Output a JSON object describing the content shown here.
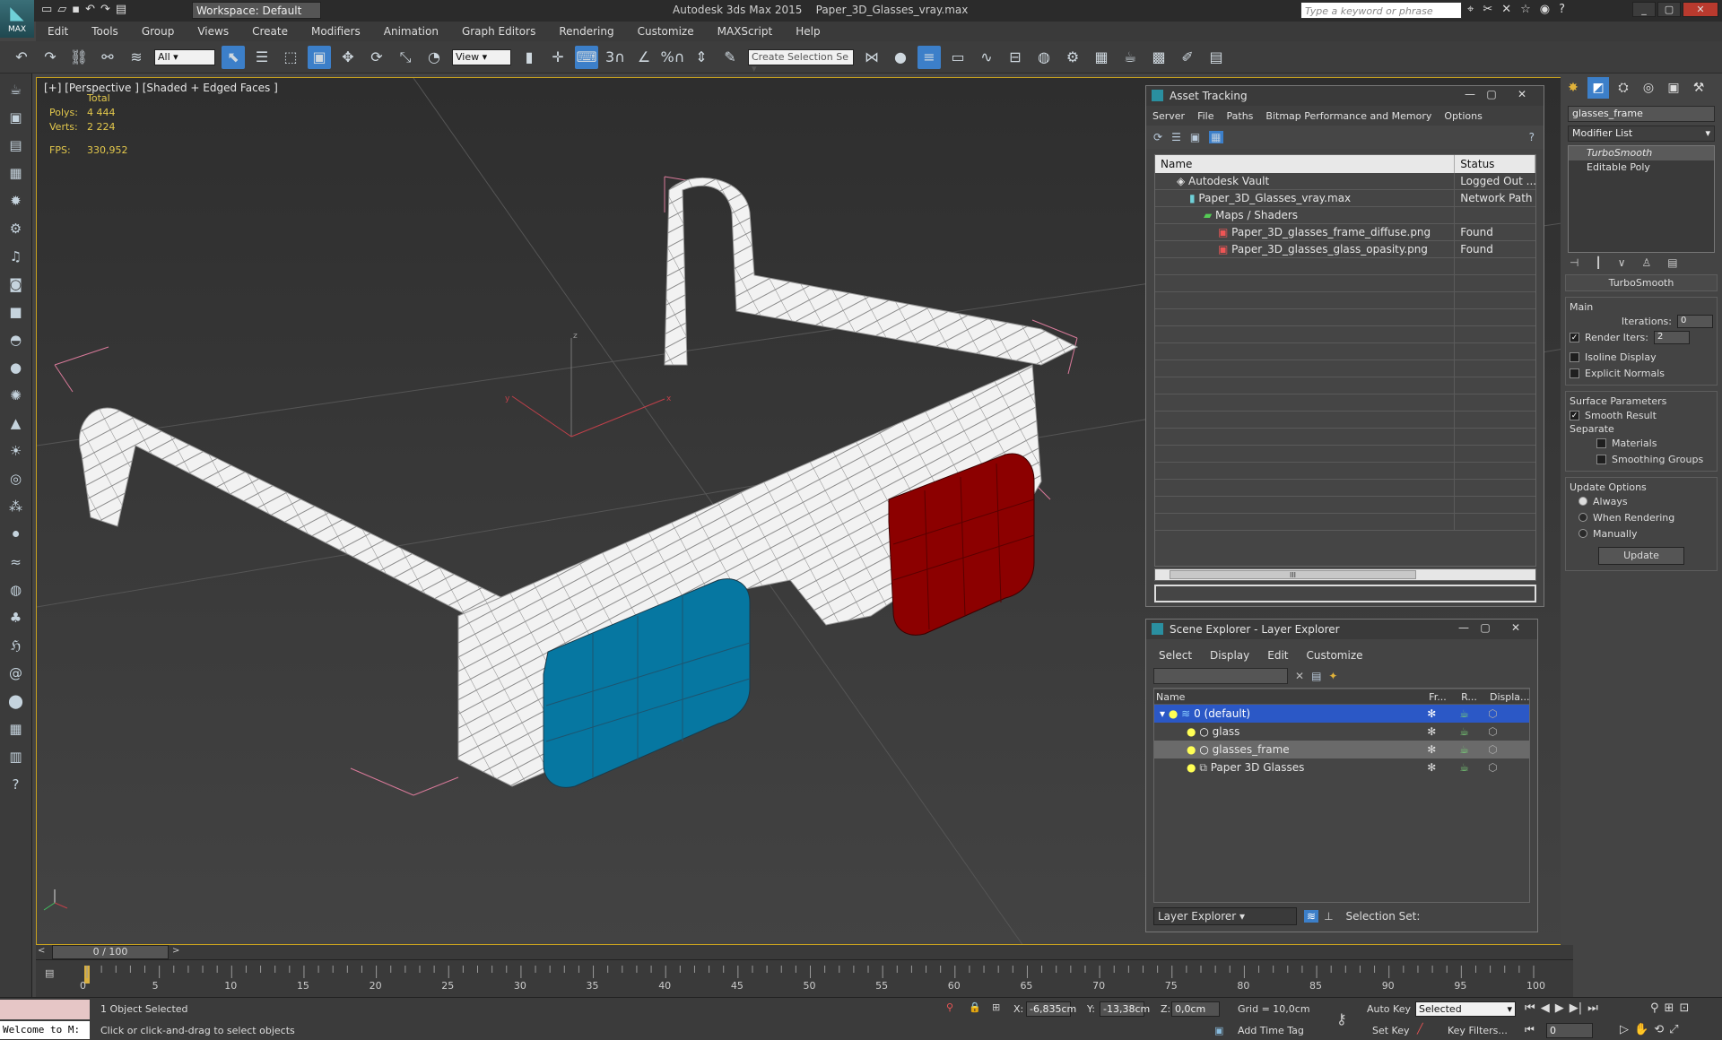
{
  "app": {
    "title_app": "Autodesk 3ds Max 2015",
    "title_file": "Paper_3D_Glasses_vray.max",
    "logo_text": "MAX",
    "workspace": "Workspace: Default",
    "search_placeholder": "Type a keyword or phrase"
  },
  "menu": [
    "Edit",
    "Tools",
    "Group",
    "Views",
    "Create",
    "Modifiers",
    "Animation",
    "Graph Editors",
    "Rendering",
    "Customize",
    "MAXScript",
    "Help"
  ],
  "toolbar": {
    "filter_value": "All",
    "view_value": "View",
    "selection_set_placeholder": "Create Selection Se",
    "snap_labels": [
      "3",
      "%",
      "n"
    ]
  },
  "viewport": {
    "label": "[+] [Perspective ] [Shaded + Edged Faces ]",
    "stats_total_label": "Total",
    "polys_label": "Polys:",
    "polys_value": "4 444",
    "verts_label": "Verts:",
    "verts_value": "2 224",
    "fps_label": "FPS:",
    "fps_value": "330,952",
    "axis_x": "x",
    "axis_y": "y",
    "axis_z": "z"
  },
  "asset_tracking": {
    "title": "Asset Tracking",
    "menu": [
      "Server",
      "File",
      "Paths",
      "Bitmap Performance and Memory",
      "Options"
    ],
    "columns": [
      "Name",
      "Status"
    ],
    "rows": [
      {
        "name": "Autodesk Vault",
        "status": "Logged Out ..."
      },
      {
        "name": "Paper_3D_Glasses_vray.max",
        "status": "Network Path"
      },
      {
        "name": "Maps / Shaders",
        "status": ""
      },
      {
        "name": "Paper_3D_glasses_frame_diffuse.png",
        "status": "Found"
      },
      {
        "name": "Paper_3D_glasses_glass_opasity.png",
        "status": "Found"
      }
    ],
    "scroll_mark": "III"
  },
  "scene_explorer": {
    "title": "Scene Explorer - Layer Explorer",
    "menu": [
      "Select",
      "Display",
      "Edit",
      "Customize"
    ],
    "columns": [
      "Name",
      "Fr...",
      "R...",
      "Displa..."
    ],
    "rows": [
      {
        "name": "0 (default)"
      },
      {
        "name": "glass"
      },
      {
        "name": "glasses_frame"
      },
      {
        "name": "Paper 3D Glasses"
      }
    ],
    "footer_dropdown": "Layer Explorer",
    "selection_set_label": "Selection Set:"
  },
  "command_panel": {
    "object_name": "glasses_frame",
    "modifier_list": "Modifier List",
    "stack": [
      "TurboSmooth",
      "Editable Poly"
    ],
    "rollout_title": "TurboSmooth",
    "main_label": "Main",
    "iterations_label": "Iterations:",
    "iterations_value": "0",
    "render_iters_label": "Render Iters:",
    "render_iters_value": "2",
    "isoline_label": "Isoline Display",
    "explicit_normals_label": "Explicit Normals",
    "surface_params_label": "Surface Parameters",
    "smooth_result_label": "Smooth Result",
    "separate_label": "Separate",
    "materials_label": "Materials",
    "smoothing_groups_label": "Smoothing Groups",
    "update_options_label": "Update Options",
    "always_label": "Always",
    "when_rendering_label": "When Rendering",
    "manually_label": "Manually",
    "update_button": "Update"
  },
  "timeline": {
    "frame_display": "0 / 100",
    "ticks": [
      "0",
      "5",
      "10",
      "15",
      "20",
      "25",
      "30",
      "35",
      "40",
      "45",
      "50",
      "55",
      "60",
      "65",
      "70",
      "75",
      "80",
      "85",
      "90",
      "95",
      "100"
    ]
  },
  "status": {
    "maxscript_listener": "Welcome to M:",
    "selected_text": "1 Object Selected",
    "prompt_text": "Click or click-and-drag to select objects",
    "x_label": "X:",
    "x_value": "-6,835cm",
    "y_label": "Y:",
    "y_value": "-13,38cm",
    "z_label": "Z:",
    "z_value": "0,0cm",
    "grid": "Grid = 10,0cm",
    "add_time_tag": "Add Time Tag",
    "auto_key": "Auto Key",
    "set_key": "Set Key",
    "selected_dropdown": "Selected",
    "key_filters": "Key Filters...",
    "frame_value": "0"
  },
  "colors": {
    "accent": "#3c7fc9",
    "viewport_border": "#c9a21e",
    "lens_red": "#8c0000",
    "lens_cyan": "#0677a1",
    "stats_yellow": "#e3c84c"
  }
}
